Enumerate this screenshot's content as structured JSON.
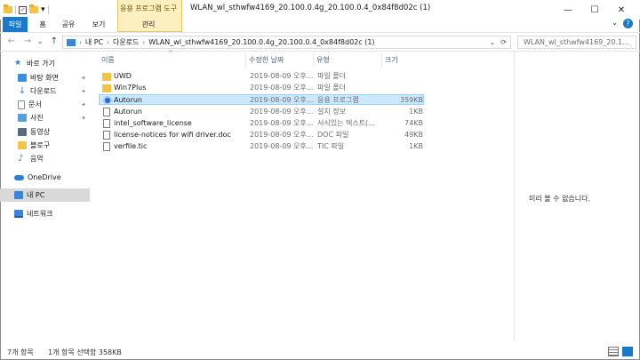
{
  "window": {
    "title": "WLAN_wl_sthwfw4169_20.100.0.4g_20.100.0.4_0x84f8d02c (1)",
    "context_group": "응용 프로그램 도구",
    "controls": [
      "—",
      "☐",
      "✕"
    ]
  },
  "ribbon": {
    "tabs": [
      "파일",
      "홈",
      "공유",
      "보기",
      "관리"
    ],
    "collapse_icon": "chevron-down",
    "help": "?"
  },
  "address": {
    "back": "←",
    "forward": "→",
    "recent": "⌄",
    "up": "↑",
    "crumbs": [
      "내 PC",
      "다운로드",
      "WLAN_wl_sthwfw4169_20.100.0.4g_20.100.0.4_0x84f8d02c (1)"
    ],
    "dropdown": "⌄",
    "refresh": "⟳"
  },
  "search": {
    "placeholder": "WLAN_wl_sthwfw4169_20.1..."
  },
  "sidebar": {
    "items": [
      {
        "label": "바로 가기",
        "icon": "star-icon",
        "color": "#2b7fd6"
      },
      {
        "label": "바탕 화면",
        "icon": "desktop-icon",
        "color": "#3b8de0",
        "pinned": true
      },
      {
        "label": "다운로드",
        "icon": "download-icon",
        "color": "#2f7fd0",
        "pinned": true
      },
      {
        "label": "문서",
        "icon": "document-icon",
        "color": "#7d8ea3",
        "pinned": true
      },
      {
        "label": "사진",
        "icon": "pictures-icon",
        "color": "#5aa0d8",
        "pinned": true
      },
      {
        "label": "동영상",
        "icon": "video-icon",
        "color": "#5a6a7e"
      },
      {
        "label": "블로구",
        "icon": "folder-icon",
        "color": "#f3c443"
      },
      {
        "label": "음악",
        "icon": "music-icon",
        "color": "#2f7fd0"
      },
      {
        "label": "OneDrive",
        "icon": "cloud-icon",
        "color": "#2f7fd0"
      },
      {
        "label": "내 PC",
        "icon": "computer-icon",
        "color": "#3a86d6",
        "selected": true
      },
      {
        "label": "네트워크",
        "icon": "network-icon",
        "color": "#3a86d6"
      }
    ],
    "pin_glyph": "📌"
  },
  "columns": [
    "이름",
    "수정한 날짜",
    "유형",
    "크기"
  ],
  "files": [
    {
      "name": "UWD",
      "date": "2019-08-09 오후...",
      "type": "파일 폴더",
      "size": "",
      "kind": "folder"
    },
    {
      "name": "Win7Plus",
      "date": "2019-08-09 오후...",
      "type": "파일 폴더",
      "size": "",
      "kind": "folder"
    },
    {
      "name": "Autorun",
      "date": "2019-08-09 오후...",
      "type": "응용 프로그램",
      "size": "359KB",
      "kind": "app",
      "selected": true
    },
    {
      "name": "Autorun",
      "date": "2019-08-09 오후...",
      "type": "설치 정보",
      "size": "1KB",
      "kind": "doc"
    },
    {
      "name": "intel_software_license",
      "date": "2019-08-09 오후...",
      "type": "서식있는 텍스트(...",
      "size": "74KB",
      "kind": "doc"
    },
    {
      "name": "license-notices for wifi driver.doc",
      "date": "2019-08-09 오후...",
      "type": "DOC 파일",
      "size": "49KB",
      "kind": "doc"
    },
    {
      "name": "verfile.tic",
      "date": "2019-08-09 오후...",
      "type": "TIC 파일",
      "size": "1KB",
      "kind": "doc"
    }
  ],
  "preview": {
    "empty_text": "미리 볼 수 없습니다."
  },
  "status": {
    "count": "7개 항목",
    "selection": "1개 항목 선택함 358KB"
  }
}
